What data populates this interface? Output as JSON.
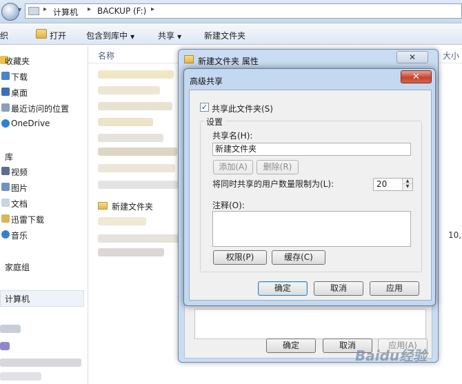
{
  "address_bar": {
    "segments": [
      "计算机",
      "BACKUP (F:)"
    ]
  },
  "command_bar": {
    "organize_label": "织",
    "open_label": "打开",
    "include_label": "包含到库中",
    "share_label": "共享",
    "newfolder_label": "新建文件夹"
  },
  "nav": {
    "favorites": "收藏夹",
    "downloads": "下载",
    "desktop": "桌面",
    "recent": "最近访问的位置",
    "onedrive": "OneDrive",
    "libraries": "库",
    "videos": "视频",
    "pictures": "图片",
    "documents": "文档",
    "xunlei": "迅雷下载",
    "music": "音乐",
    "homegroup": "家庭组",
    "computer": "计算机"
  },
  "file_list": {
    "name_header": "名称",
    "size_header": "大小",
    "new_folder_item": "新建文件夹",
    "size_value": "10,"
  },
  "properties_dialog": {
    "title": "新建文件夹 属性",
    "close_glyph": "✕",
    "ok_label": "确定",
    "cancel_label": "取消",
    "apply_label": "应用(A)"
  },
  "advanced_sharing": {
    "title": "高级共享",
    "close_glyph": "✕",
    "share_checkbox_label": "共享此文件夹(S)",
    "share_checked": true,
    "check_glyph": "✓",
    "settings_group": "设置",
    "share_name_label": "共享名(H):",
    "share_name_value": "新建文件夹",
    "add_label": "添加(A)",
    "remove_label": "删除(R)",
    "user_limit_label": "将同时共享的用户数量限制为(L):",
    "user_limit_value": "20",
    "spin_up": "▲",
    "spin_down": "▼",
    "comment_label": "注释(O):",
    "permissions_label": "权限(P)",
    "caching_label": "缓存(C)",
    "ok_label": "确定",
    "cancel_label": "取消",
    "apply_label": "应用"
  },
  "watermark": "Baidu经验"
}
